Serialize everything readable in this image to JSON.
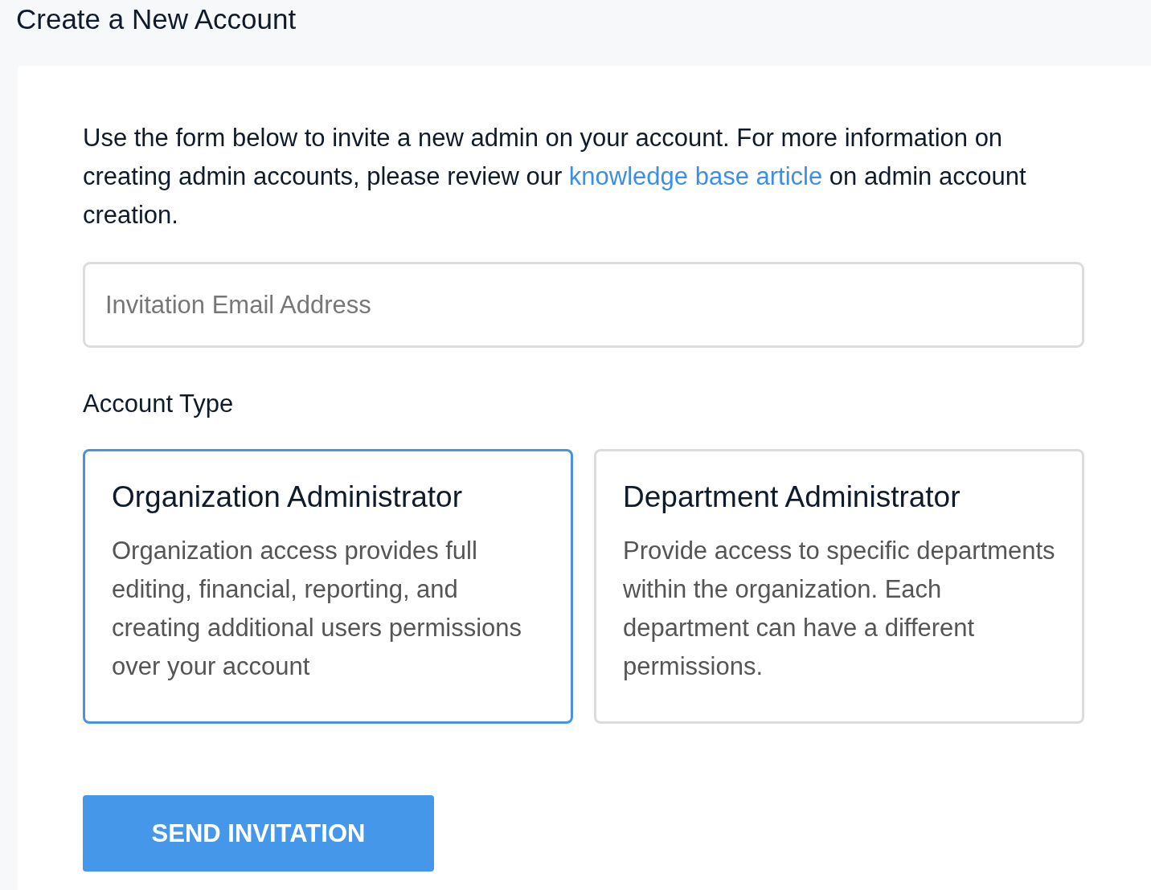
{
  "page_title": "Create a New Account",
  "intro": {
    "before": "Use the form below to invite a new admin on your account. For more information on creating admin accounts, please review our ",
    "link": "knowledge base article",
    "after": " on admin account creation."
  },
  "email_field": {
    "placeholder": "Invitation Email Address"
  },
  "account_type": {
    "label": "Account Type",
    "options": [
      {
        "title": "Organization Administrator",
        "description": "Organization access provides full editing, financial, reporting, and creating additional users permissions over your account",
        "selected": true
      },
      {
        "title": "Department Administrator",
        "description": "Provide access to specific departments within the organization. Each department can have a different permissions.",
        "selected": false
      }
    ]
  },
  "submit_button": "SEND INVITATION"
}
